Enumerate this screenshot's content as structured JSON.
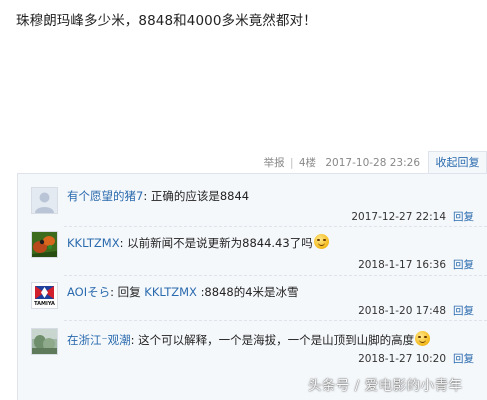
{
  "post": {
    "text": "珠穆朗玛峰多少米，8848和4000多米竟然都对！"
  },
  "meta": {
    "report": "举报",
    "separator": "|",
    "floor": "4楼",
    "datetime": "2017-10-28 23:26",
    "collapse_label": "收起回复"
  },
  "replies": [
    {
      "user": "有个愿望的猪7",
      "colon": ":",
      "prefix": "",
      "target": "",
      "text": "正确的应该是8844",
      "emoji": false,
      "date": "2017-12-27 22:14",
      "reply_label": "回复",
      "avatar": "default-avatar"
    },
    {
      "user": "KKLTZMX",
      "colon": ":",
      "prefix": "",
      "target": "",
      "text": "以前新闻不是说更新为8844.43了吗",
      "emoji": true,
      "date": "2018-1-17 16:36",
      "reply_label": "回复",
      "avatar": "frog-avatar"
    },
    {
      "user": "AOIそら",
      "colon": ":",
      "prefix": "回复 ",
      "target": "KKLTZMX",
      "text": ":8848的4米是冰雪",
      "emoji": false,
      "date": "2018-1-20 17:48",
      "reply_label": "回复",
      "avatar": "tamiya-avatar",
      "avatar_text": "TAMIYA"
    },
    {
      "user": "在浙江⁻观潮",
      "colon": ":",
      "prefix": "",
      "target": "",
      "text": "这个可以解释，一个是海拔，一个是山顶到山脚的高度",
      "emoji": true,
      "date": "2018-1-27 10:20",
      "reply_label": "回复",
      "avatar": "landscape-avatar"
    }
  ],
  "watermark": "头条号 / 爱电影的小青年",
  "colors": {
    "link": "#2a6aae",
    "reply_bg": "#f5f8fb",
    "border": "#dfe4ec",
    "meta_text": "#888888"
  }
}
